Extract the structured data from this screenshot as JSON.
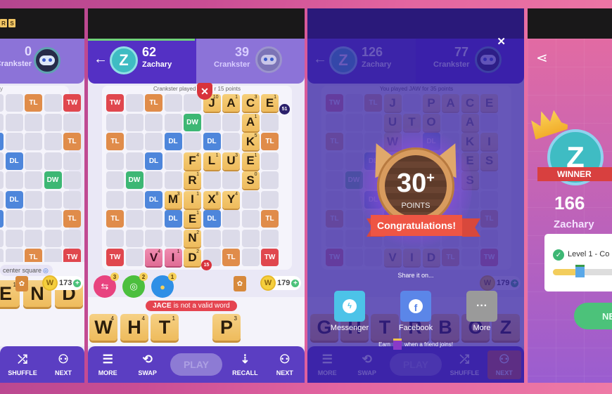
{
  "panel1": {
    "logo_letters": [
      "R",
      "S"
    ],
    "opponent": {
      "name": "Crankster",
      "score": "0"
    },
    "board_hint": "y",
    "coins": "173",
    "hint_text": "center square",
    "rack": [
      {
        "l": "E",
        "v": "1"
      },
      {
        "l": "N",
        "v": "2"
      },
      {
        "l": "D",
        "v": "2"
      }
    ],
    "nav": [
      "SHUFFLE",
      "NEXT"
    ],
    "cells": [
      {
        "r": 0,
        "c": 1,
        "t": "TL"
      },
      {
        "r": 0,
        "c": 3,
        "t": "TW"
      },
      {
        "r": 2,
        "c": -1,
        "t": "DL"
      },
      {
        "r": 2,
        "c": 3,
        "t": "TL"
      },
      {
        "r": 3,
        "c": 0,
        "t": "DL"
      },
      {
        "r": 4,
        "c": 2,
        "t": "DW"
      },
      {
        "r": 5,
        "c": 0,
        "t": "DL"
      },
      {
        "r": 6,
        "c": -1,
        "t": "DL"
      },
      {
        "r": 6,
        "c": 3,
        "t": "TL"
      },
      {
        "r": 8,
        "c": 1,
        "t": "TL"
      },
      {
        "r": 8,
        "c": 3,
        "t": "TW"
      }
    ]
  },
  "panel2": {
    "player": {
      "initial": "Z",
      "name": "Zachary",
      "score": "62"
    },
    "opponent": {
      "name": "Crankster",
      "score": "39"
    },
    "last_move": "Crankster played",
    "last_move_tail": "r 15 points",
    "premium": [
      {
        "r": 0,
        "c": 0,
        "t": "TW"
      },
      {
        "r": 0,
        "c": 2,
        "t": "TL"
      },
      {
        "r": 1,
        "c": 4,
        "t": "DW"
      },
      {
        "r": 2,
        "c": 0,
        "t": "TL"
      },
      {
        "r": 2,
        "c": 3,
        "t": "DL"
      },
      {
        "r": 2,
        "c": 5,
        "t": "DL"
      },
      {
        "r": 2,
        "c": 8,
        "t": "TL"
      },
      {
        "r": 3,
        "c": 2,
        "t": "DL"
      },
      {
        "r": 4,
        "c": 1,
        "t": "DW"
      },
      {
        "r": 5,
        "c": 2,
        "t": "DL"
      },
      {
        "r": 6,
        "c": 0,
        "t": "TL"
      },
      {
        "r": 6,
        "c": 3,
        "t": "DL"
      },
      {
        "r": 6,
        "c": 5,
        "t": "DL"
      },
      {
        "r": 6,
        "c": 8,
        "t": "TL"
      },
      {
        "r": 8,
        "c": 0,
        "t": "TW"
      },
      {
        "r": 8,
        "c": 6,
        "t": "TL"
      },
      {
        "r": 8,
        "c": 8,
        "t": "TW"
      }
    ],
    "tiles": [
      {
        "r": 0,
        "c": 5,
        "l": "J",
        "v": "10"
      },
      {
        "r": 0,
        "c": 6,
        "l": "A",
        "v": "1"
      },
      {
        "r": 0,
        "c": 7,
        "l": "C",
        "v": "3"
      },
      {
        "r": 0,
        "c": 8,
        "l": "E",
        "v": "1"
      },
      {
        "r": 1,
        "c": 7,
        "l": "A",
        "v": "1"
      },
      {
        "r": 2,
        "c": 7,
        "l": "K",
        "v": "5"
      },
      {
        "r": 3,
        "c": 4,
        "l": "F",
        "v": "4"
      },
      {
        "r": 3,
        "c": 5,
        "l": "L",
        "v": "1"
      },
      {
        "r": 3,
        "c": 6,
        "l": "U",
        "v": "3"
      },
      {
        "r": 3,
        "c": 7,
        "l": "E",
        "v": "1"
      },
      {
        "r": 4,
        "c": 4,
        "l": "R",
        "v": "1"
      },
      {
        "r": 4,
        "c": 7,
        "l": "S",
        "v": "0"
      },
      {
        "r": 5,
        "c": 3,
        "l": "M",
        "v": "3"
      },
      {
        "r": 5,
        "c": 4,
        "l": "I",
        "v": "1"
      },
      {
        "r": 5,
        "c": 5,
        "l": "X",
        "v": "8"
      },
      {
        "r": 5,
        "c": 6,
        "l": "Y",
        "v": "4"
      },
      {
        "r": 6,
        "c": 4,
        "l": "E",
        "v": "1"
      },
      {
        "r": 7,
        "c": 4,
        "l": "N",
        "v": "2"
      },
      {
        "r": 8,
        "c": 4,
        "l": "D",
        "v": "2"
      }
    ],
    "pending": [
      {
        "r": 8,
        "c": 2,
        "l": "V",
        "v": "4"
      },
      {
        "r": 8,
        "c": 3,
        "l": "I",
        "v": "1"
      }
    ],
    "score_bubble_top": "51",
    "score_bubble_bottom": "15",
    "powerups": [
      {
        "count": "3",
        "color": "#e8427f",
        "icon": "⇆"
      },
      {
        "count": "2",
        "color": "#4cbf3e",
        "icon": "◎"
      },
      {
        "count": "1",
        "color": "#2f8fe6",
        "icon": "💡"
      }
    ],
    "coins": "179",
    "error_word": "JACE",
    "error_tail": "is not a valid word",
    "rack": [
      {
        "l": "W",
        "v": "4"
      },
      {
        "l": "H",
        "v": "4"
      },
      {
        "l": "T",
        "v": "1"
      },
      {
        "l": "",
        "v": ""
      },
      {
        "l": "P",
        "v": "3"
      }
    ],
    "nav": {
      "more": "MORE",
      "swap": "SWAP",
      "play": "PLAY",
      "recall": "RECALL",
      "next": "NEXT"
    }
  },
  "panel3": {
    "player": {
      "initial": "Z",
      "name": "Zachary",
      "score": "126"
    },
    "opponent": {
      "name": "Crankster",
      "score": "77"
    },
    "last_move": "You played JAW for 35 points",
    "badge_points": "30",
    "badge_plus": "+",
    "badge_label": "POINTS",
    "congrats": "Congratulations!",
    "share_prompt": "Share it on...",
    "share_options": [
      {
        "label": "Messenger",
        "color": "#4cc3e8"
      },
      {
        "label": "Facebook",
        "color": "#5b86e8"
      },
      {
        "label": "More",
        "color": "#9a9a9a"
      }
    ],
    "earn_text": "Earn",
    "earn_tail": "when a friend joins!",
    "bg_letters": [
      "J",
      "P",
      "A",
      "C",
      "E",
      "A",
      "U",
      "T",
      "O",
      "A",
      "W",
      "K",
      "I",
      "E",
      "S",
      "S",
      "V",
      "I",
      "D"
    ],
    "rack_letters": [
      "G",
      "H",
      "T",
      "R",
      "B",
      "O",
      "Z"
    ],
    "coins": "179",
    "nav": {
      "more": "MORE",
      "swap": "SWAP",
      "play": "PLAY",
      "shuffle": "SHUFFLE",
      "next": "NEXT"
    }
  },
  "panel4": {
    "winner_initial": "Z",
    "winner_label": "WINNER",
    "score": "166",
    "name": "Zachary",
    "level_text": "Level 1 - Co",
    "level_progress": 0.35,
    "next_label": "NE"
  }
}
